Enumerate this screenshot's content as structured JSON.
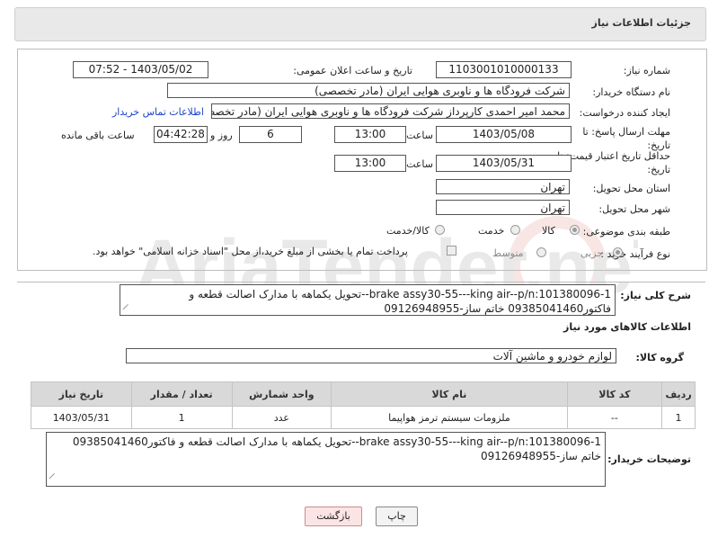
{
  "header": {
    "title": "جزئیات اطلاعات نیاز"
  },
  "form": {
    "need_number": {
      "label": "شماره نیاز:",
      "value": "1103001010000133"
    },
    "announce_datetime": {
      "label": "تاریخ و ساعت اعلان عمومی:",
      "value": "1403/05/02 - 07:52"
    },
    "buyer_org": {
      "label": "نام دستگاه خریدار:",
      "value": "شرکت فرودگاه ها و ناوبری هوایی ایران (مادر تخصصی)"
    },
    "requester": {
      "label": "ایجاد کننده درخواست:",
      "value": "محمد امیر احمدی کارپرداز شرکت فرودگاه ها و ناوبری هوایی ایران (مادر تخصصی)",
      "contact_link": "اطلاعات تماس خریدار"
    },
    "response_deadline": {
      "label_line1": "مهلت ارسال پاسخ: تا",
      "label_line2": "تاریخ:",
      "date": "1403/05/08",
      "time_label": "ساعت",
      "time": "13:00",
      "days": "6",
      "days_label": "روز و",
      "remaining": "04:42:28",
      "remaining_label": "ساعت باقی مانده"
    },
    "price_validity": {
      "label_line1": "حداقل تاریخ اعتبار قیمت: تا",
      "label_line2": "تاریخ:",
      "date": "1403/05/31",
      "time_label": "ساعت",
      "time": "13:00"
    },
    "delivery_province": {
      "label": "استان محل تحویل:",
      "value": "تهران"
    },
    "delivery_city": {
      "label": "شهر محل تحویل:",
      "value": "تهران"
    },
    "category": {
      "label": "طبقه بندی موضوعی:",
      "options": [
        "کالا",
        "خدمت",
        "کالا/خدمت"
      ],
      "selected": "کالا"
    },
    "process_type": {
      "label": "نوع فرآیند خرید :",
      "options": [
        "جزیی",
        "متوسط"
      ],
      "selected": "جزیی",
      "treasury_note": "پرداخت تمام یا بخشی از مبلغ خرید،از محل \"اسناد خزانه اسلامی\" خواهد بود."
    }
  },
  "general_description": {
    "label": "شرح کلی نیاز:",
    "value": "brake assy30-55---king air--p/n:101380096-1--تحویل یکماهه با مدارک اصالت قطعه و فاکتور09385041460 خاتم ساز-09126948955"
  },
  "goods_section": {
    "title": "اطلاعات کالاهای مورد نیاز",
    "group_label": "گروه کالا:",
    "group_value": "لوازم خودرو و ماشین آلات"
  },
  "table": {
    "headers": [
      "ردیف",
      "کد کالا",
      "نام کالا",
      "واحد شمارش",
      "تعداد / مقدار",
      "تاریخ نیاز"
    ],
    "rows": [
      [
        "1",
        "--",
        "ملزومات سیستم ترمز هواپیما",
        "عدد",
        "1",
        "1403/05/31"
      ]
    ]
  },
  "buyer_notes": {
    "label": "توضیحات خریدار:",
    "value": "brake assy30-55---king air--p/n:101380096-1--تحویل یکماهه با مدارک اصالت قطعه و فاکتور09385041460 خاتم ساز-09126948955"
  },
  "buttons": {
    "print": "چاپ",
    "back": "بازگشت"
  },
  "watermark": {
    "text": "AriaTender.neT"
  },
  "colors": {
    "link": "#1a44c8",
    "back_button": "#fde4e4",
    "watermark": "#c0392b"
  }
}
